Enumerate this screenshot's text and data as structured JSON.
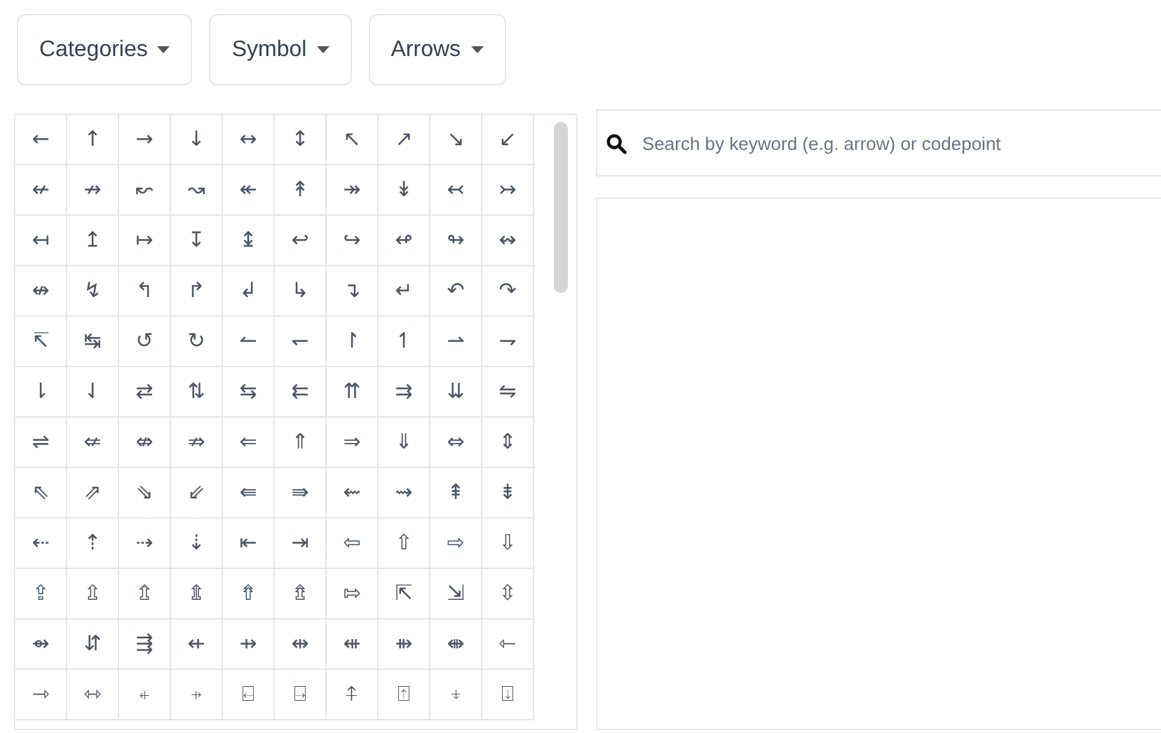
{
  "dropdowns": [
    {
      "label": "Categories"
    },
    {
      "label": "Symbol"
    },
    {
      "label": "Arrows"
    }
  ],
  "symbol_grid": [
    [
      "←",
      "↑",
      "→",
      "↓",
      "↔",
      "↕",
      "↖",
      "↗",
      "↘",
      "↙"
    ],
    [
      "↚",
      "↛",
      "↜",
      "↝",
      "↞",
      "↟",
      "↠",
      "↡",
      "↢",
      "↣"
    ],
    [
      "↤",
      "↥",
      "↦",
      "↧",
      "↨",
      "↩",
      "↪",
      "↫",
      "↬",
      "↭"
    ],
    [
      "↮",
      "↯",
      "↰",
      "↱",
      "↲",
      "↳",
      "↴",
      "↵",
      "↶",
      "↷"
    ],
    [
      "↸",
      "↹",
      "↺",
      "↻",
      "↼",
      "↽",
      "↾",
      "↿",
      "⇀",
      "⇁"
    ],
    [
      "⇂",
      "⇃",
      "⇄",
      "⇅",
      "⇆",
      "⇇",
      "⇈",
      "⇉",
      "⇊",
      "⇋"
    ],
    [
      "⇌",
      "⇍",
      "⇎",
      "⇏",
      "⇐",
      "⇑",
      "⇒",
      "⇓",
      "⇔",
      "⇕"
    ],
    [
      "⇖",
      "⇗",
      "⇘",
      "⇙",
      "⇚",
      "⇛",
      "⇜",
      "⇝",
      "⇞",
      "⇟"
    ],
    [
      "⇠",
      "⇡",
      "⇢",
      "⇣",
      "⇤",
      "⇥",
      "⇦",
      "⇧",
      "⇨",
      "⇩"
    ],
    [
      "⇪",
      "⇫",
      "⇬",
      "⇭",
      "⇮",
      "⇯",
      "⇰",
      "⇱",
      "⇲",
      "⇳"
    ],
    [
      "⇴",
      "⇵",
      "⇶",
      "⇷",
      "⇸",
      "⇹",
      "⇺",
      "⇻",
      "⇼",
      "⇽"
    ],
    [
      "⇾",
      "⇿",
      "⍅",
      "⍆",
      "⍇",
      "⍈",
      "⍏",
      "⍐",
      "⍖",
      "⍗"
    ]
  ],
  "search": {
    "placeholder": "Search by keyword (e.g. arrow) or codepoint"
  }
}
